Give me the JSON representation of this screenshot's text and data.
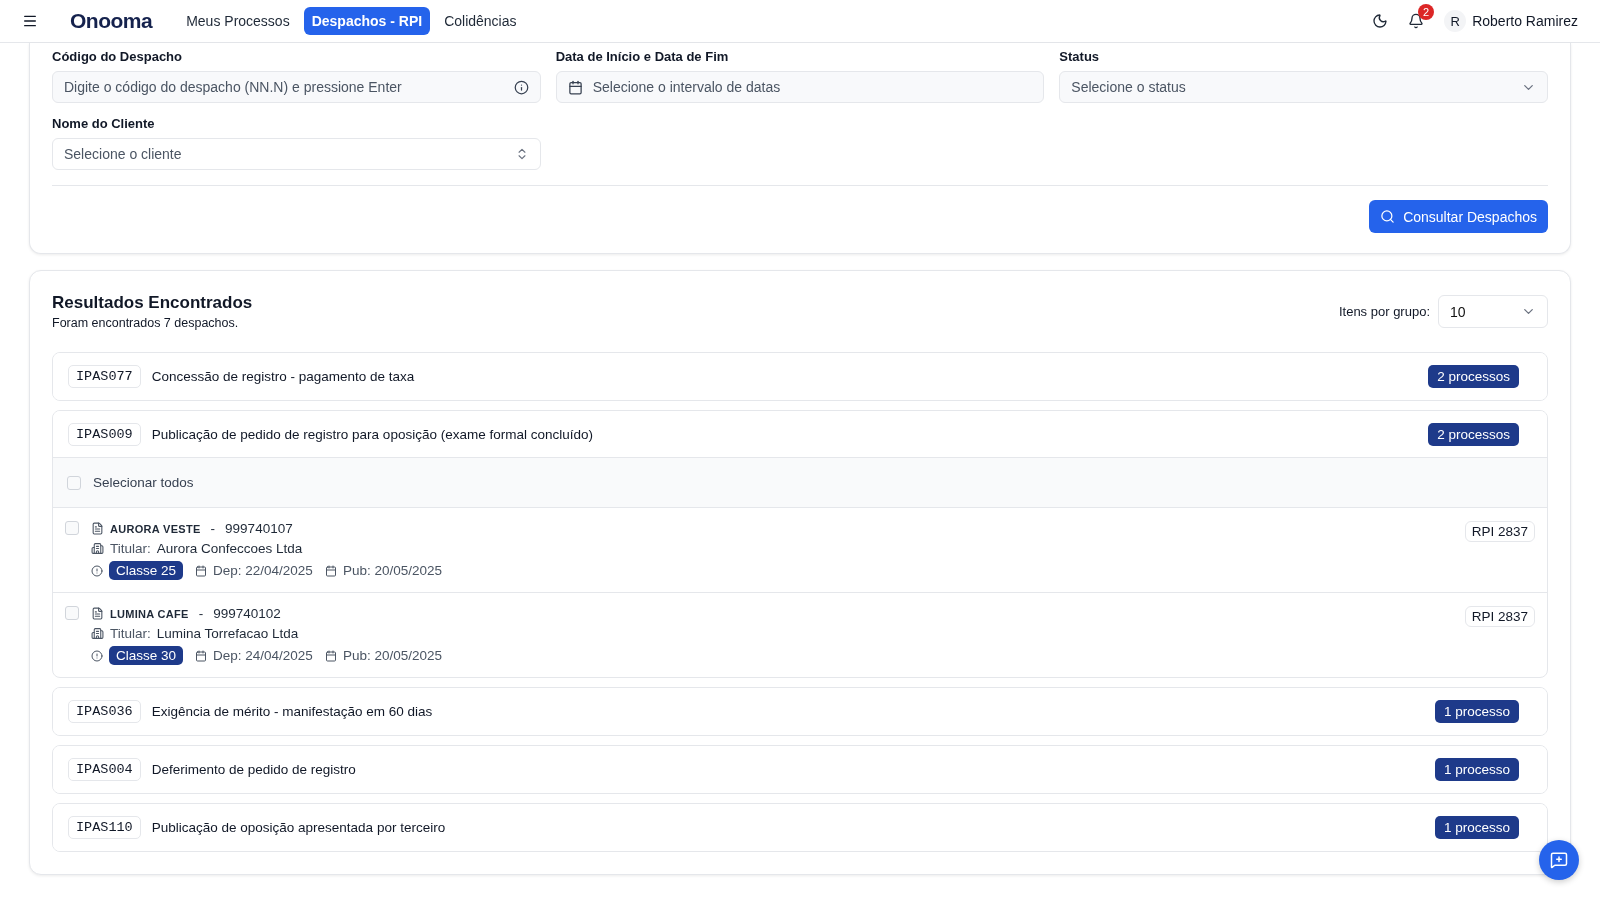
{
  "header": {
    "logo": "Onooma",
    "nav": [
      {
        "label": "Meus Processos",
        "selected": false
      },
      {
        "label": "Despachos - RPI",
        "selected": true
      },
      {
        "label": "Colidências",
        "selected": false
      }
    ],
    "notifications": "2",
    "user_initial": "R",
    "user_name": "Roberto Ramirez"
  },
  "filters": {
    "fields": [
      {
        "kind": "text",
        "label": "Código do Despacho",
        "placeholder": "Digite o código do despacho (NN.N) e pressione Enter"
      },
      {
        "kind": "date",
        "label": "Data de Início e Data de Fim",
        "placeholder": "Selecione o intervalo de datas"
      },
      {
        "kind": "select",
        "label": "Status",
        "placeholder": "Selecione o status"
      },
      {
        "kind": "combo",
        "label": "Nome do Cliente",
        "placeholder": "Selecione o cliente"
      }
    ],
    "submit": "Consultar Despachos"
  },
  "results": {
    "title": "Resultados Encontrados",
    "subtitle": "Foram encontrados 7 despachos.",
    "per_group_label": "Itens por grupo:",
    "per_group_value": "10",
    "groups": [
      {
        "code": "IPAS077",
        "title": "Concessão de registro - pagamento de taxa",
        "count": "2 processos",
        "expanded": false
      },
      {
        "code": "IPAS009",
        "title": "Publicação de pedido de registro para oposição (exame formal concluído)",
        "count": "2 processos",
        "expanded": true,
        "select_all": {
          "label": "Selecionar todos",
          "checked": false
        },
        "items": [
          {
            "brand": "AURORA VESTE",
            "separator": "-",
            "number": "999740107",
            "holder_label": "Titular:",
            "holder": "Aurora Confeccoes Ltda",
            "class": "Classe 25",
            "dep": "Dep: 22/04/2025",
            "pub": "Pub: 20/05/2025",
            "rpi": "RPI 2837",
            "checked": false
          },
          {
            "brand": "LUMINA CAFE",
            "separator": "-",
            "number": "999740102",
            "holder_label": "Titular:",
            "holder": "Lumina Torrefacao Ltda",
            "class": "Classe 30",
            "dep": "Dep: 24/04/2025",
            "pub": "Pub: 20/05/2025",
            "rpi": "RPI 2837",
            "checked": false
          }
        ]
      },
      {
        "code": "IPAS036",
        "title": "Exigência de mérito - manifestação em 60 dias",
        "count": "1 processo",
        "expanded": false
      },
      {
        "code": "IPAS004",
        "title": "Deferimento de pedido de registro",
        "count": "1 processo",
        "expanded": false
      },
      {
        "code": "IPAS110",
        "title": "Publicação de oposição apresentada por terceiro",
        "count": "1 processo",
        "expanded": false
      }
    ]
  }
}
